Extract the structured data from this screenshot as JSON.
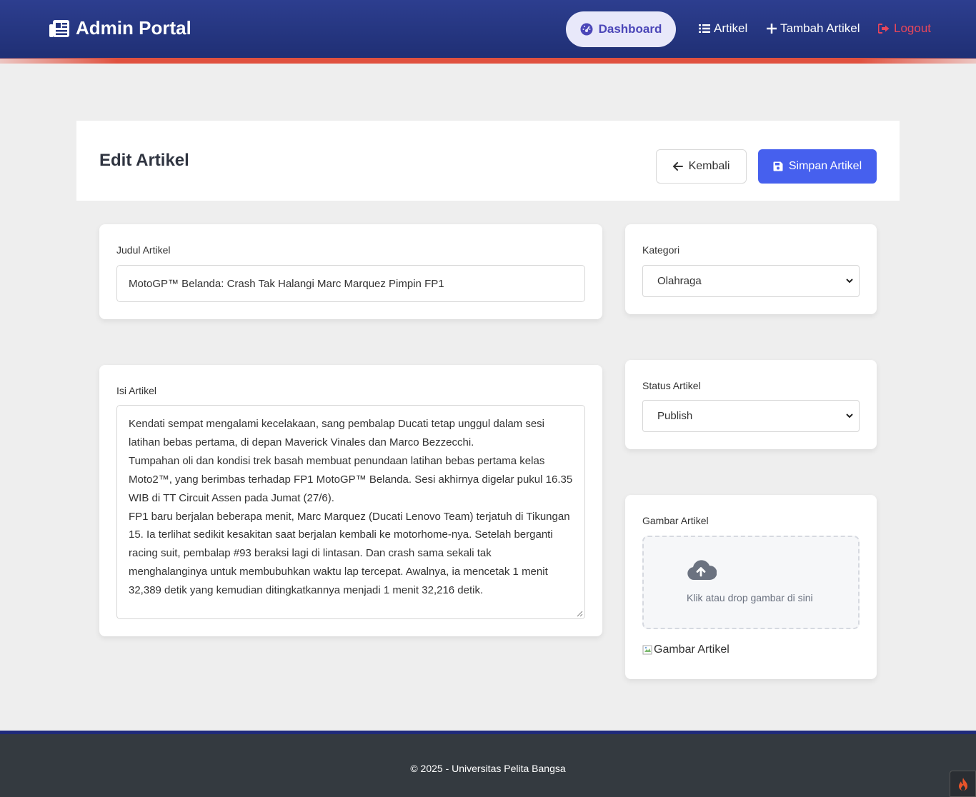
{
  "nav": {
    "brand": "Admin Portal",
    "brand_icon": "newspaper-icon",
    "items": [
      {
        "label": "Dashboard",
        "icon": "gauge-icon",
        "active": true
      },
      {
        "label": "Artikel",
        "icon": "list-icon"
      },
      {
        "label": "Tambah Artikel",
        "icon": "plus-icon"
      },
      {
        "label": "Logout",
        "icon": "sign-out-icon",
        "color": "#e8465a"
      }
    ]
  },
  "page": {
    "title": "Edit Artikel",
    "back_label": "Kembali",
    "save_label": "Simpan Artikel"
  },
  "form": {
    "judul_label": "Judul Artikel",
    "judul_value": "MotoGP™ Belanda: Crash Tak Halangi Marc Marquez Pimpin FP1",
    "isi_label": "Isi Artikel",
    "isi_paragraphs": [
      "Kendati sempat mengalami kecelakaan, sang pembalap Ducati tetap unggul dalam sesi latihan bebas pertama, di depan Maverick Vinales dan Marco Bezzecchi.",
      "Tumpahan oli dan kondisi trek basah membuat penundaan latihan bebas pertama kelas Moto2™, yang berimbas terhadap FP1 MotoGP™ Belanda. Sesi akhirnya digelar pukul 16.35 WIB di TT Circuit Assen pada Jumat (27/6).",
      "FP1 baru berjalan beberapa menit, Marc Marquez (Ducati Lenovo Team) terjatuh di Tikungan 15. Ia terlihat sedikit kesakitan saat berjalan kembali ke motorhome-nya. Setelah berganti racing suit, pembalap #93 beraksi lagi di lintasan. Dan crash sama sekali tak menghalanginya untuk membubuhkan waktu lap tercepat. Awalnya, ia mencetak 1 menit 32,389 detik yang kemudian ditingkatkannya menjadi 1 menit 32,216 detik."
    ],
    "kategori_label": "Kategori",
    "kategori_value": "Olahraga",
    "status_label": "Status Artikel",
    "status_value": "Publish",
    "gambar_label": "Gambar Artikel",
    "dropzone_text": "Klik atau drop gambar di sini",
    "image_alt": "Gambar Artikel"
  },
  "footer": {
    "text": "© 2025 - Universitas Pelita Bangsa"
  },
  "colors": {
    "nav_bg": "#24357f",
    "accent": "#4660ee",
    "danger": "#e8465a",
    "footer_bg": "#343a40"
  }
}
